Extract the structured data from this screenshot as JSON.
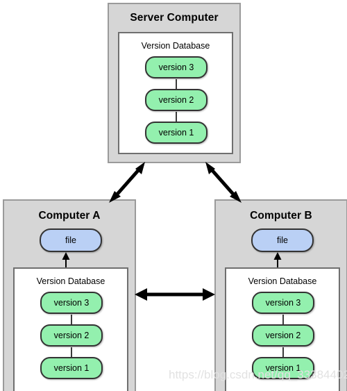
{
  "diagram": {
    "title_semantics": "centralized-version-control-system",
    "background_color": "#ffffff",
    "panel_fill": "#d6d6d6",
    "panel_border": "#9a9a9a",
    "inner_fill": "#ffffff",
    "inner_border": "#6f6f6f",
    "version_pill_color": "#93f0ae",
    "file_pill_color": "#bad0f5",
    "pill_border_color": "#333333",
    "arrow_color": "#000000"
  },
  "server": {
    "title": "Server Computer",
    "database": {
      "label": "Version Database",
      "versions": [
        {
          "label": "version 3"
        },
        {
          "label": "version 2"
        },
        {
          "label": "version 1"
        }
      ]
    }
  },
  "computer_a": {
    "title": "Computer A",
    "file": {
      "label": "file"
    },
    "database": {
      "label": "Version Database",
      "versions": [
        {
          "label": "version 3"
        },
        {
          "label": "version 2"
        },
        {
          "label": "version 1"
        }
      ]
    }
  },
  "computer_b": {
    "title": "Computer B",
    "file": {
      "label": "file"
    },
    "database": {
      "label": "Version Database",
      "versions": [
        {
          "label": "version 3"
        },
        {
          "label": "version 2"
        },
        {
          "label": "version 1"
        }
      ]
    }
  },
  "connections": [
    {
      "name": "server-to-computer-a",
      "style": "double-headed",
      "orientation": "diagonal"
    },
    {
      "name": "server-to-computer-b",
      "style": "double-headed",
      "orientation": "diagonal"
    },
    {
      "name": "computer-a-to-computer-b",
      "style": "double-headed",
      "orientation": "horizontal"
    },
    {
      "name": "database-to-file-a",
      "style": "single-headed-up",
      "orientation": "vertical"
    },
    {
      "name": "database-to-file-b",
      "style": "single-headed-up",
      "orientation": "vertical"
    }
  ],
  "watermark": {
    "text": "https://blog.csdn.net/qq_33384402"
  }
}
